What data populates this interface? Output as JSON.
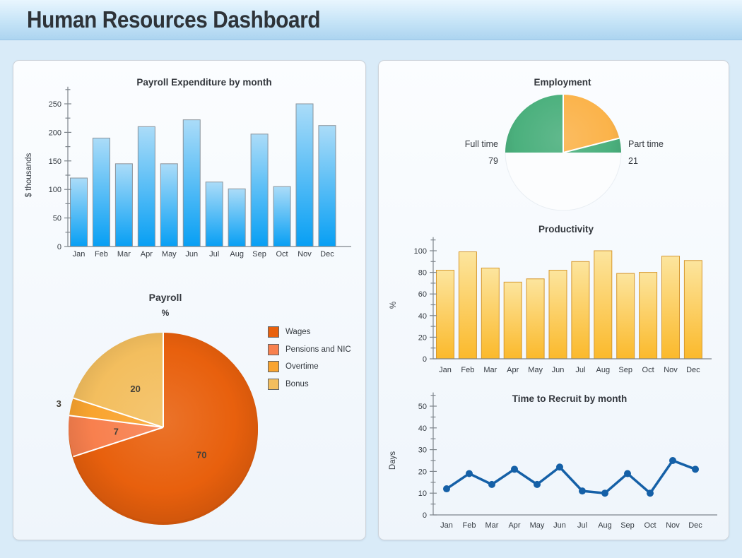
{
  "header": {
    "title": "Human Resources Dashboard"
  },
  "theme": {
    "page_bg": "#D9EBF8",
    "header_gradient": [
      "#E9F6FE",
      "#C6E4F7",
      "#ACD4F0"
    ],
    "panel_bg": "#F3F8FC",
    "panel_border": "#CDD3DA",
    "axis_color": "#7E858C",
    "text_color": "#363C43"
  },
  "chart_data": [
    {
      "id": "payroll-expenditure",
      "type": "bar",
      "title": "Payroll Expenditure by month",
      "xlabel": "",
      "ylabel": "$ thousands",
      "categories": [
        "Jan",
        "Feb",
        "Mar",
        "Apr",
        "May",
        "Jun",
        "Jul",
        "Aug",
        "Sep",
        "Oct",
        "Nov",
        "Dec"
      ],
      "values": [
        120,
        190,
        145,
        210,
        145,
        222,
        113,
        101,
        197,
        105,
        250,
        212
      ],
      "ylim": [
        0,
        250
      ],
      "ytick_step": 50,
      "yminor_step": 25,
      "grid": false,
      "bar_color_top": "#ABDCF8",
      "bar_color_bottom": "#079FF4",
      "bar_border": "#8A939B"
    },
    {
      "id": "payroll-breakdown",
      "type": "pie",
      "title": "Payroll",
      "subtitle": "%",
      "legend_position": "right",
      "slices": [
        {
          "label": "Wages",
          "value": 70,
          "color": "#E8600D"
        },
        {
          "label": "Pensions and NIC",
          "value": 7,
          "color": "#F8804E"
        },
        {
          "label": "Overtime",
          "value": 3,
          "color": "#F9A42F"
        },
        {
          "label": "Bonus",
          "value": 20,
          "color": "#F3BE5E"
        }
      ]
    },
    {
      "id": "employment",
      "type": "half-pie",
      "title": "Employment",
      "slices": [
        {
          "label": "Part time",
          "value": 21,
          "color": "#FBB34A"
        },
        {
          "label": "Full time",
          "value": 79,
          "color": "#4BB07D"
        }
      ]
    },
    {
      "id": "productivity",
      "type": "bar",
      "title": "Productivity",
      "xlabel": "",
      "ylabel": "%",
      "categories": [
        "Jan",
        "Feb",
        "Mar",
        "Apr",
        "May",
        "Jun",
        "Jul",
        "Aug",
        "Sep",
        "Oct",
        "Nov",
        "Dec"
      ],
      "values": [
        82,
        99,
        84,
        71,
        74,
        82,
        90,
        100,
        79,
        80,
        95,
        91
      ],
      "ylim": [
        0,
        100
      ],
      "ytick_step": 20,
      "yminor_step": 10,
      "grid": false,
      "bar_color_top": "#FCE59E",
      "bar_color_bottom": "#FBB92B",
      "bar_border": "#D6982F"
    },
    {
      "id": "time-to-recruit",
      "type": "line",
      "title": "Time to Recruit by month",
      "xlabel": "",
      "ylabel": "Days",
      "categories": [
        "Jan",
        "Feb",
        "Mar",
        "Apr",
        "May",
        "Jun",
        "Jul",
        "Aug",
        "Sep",
        "Oct",
        "Nov",
        "Dec"
      ],
      "values": [
        12,
        19,
        14,
        21,
        14,
        22,
        11,
        10,
        19,
        10,
        25,
        21
      ],
      "ylim": [
        0,
        50
      ],
      "ytick_step": 10,
      "yminor_step": 5,
      "grid": false,
      "line_color": "#1560A7",
      "marker": "circle"
    }
  ]
}
